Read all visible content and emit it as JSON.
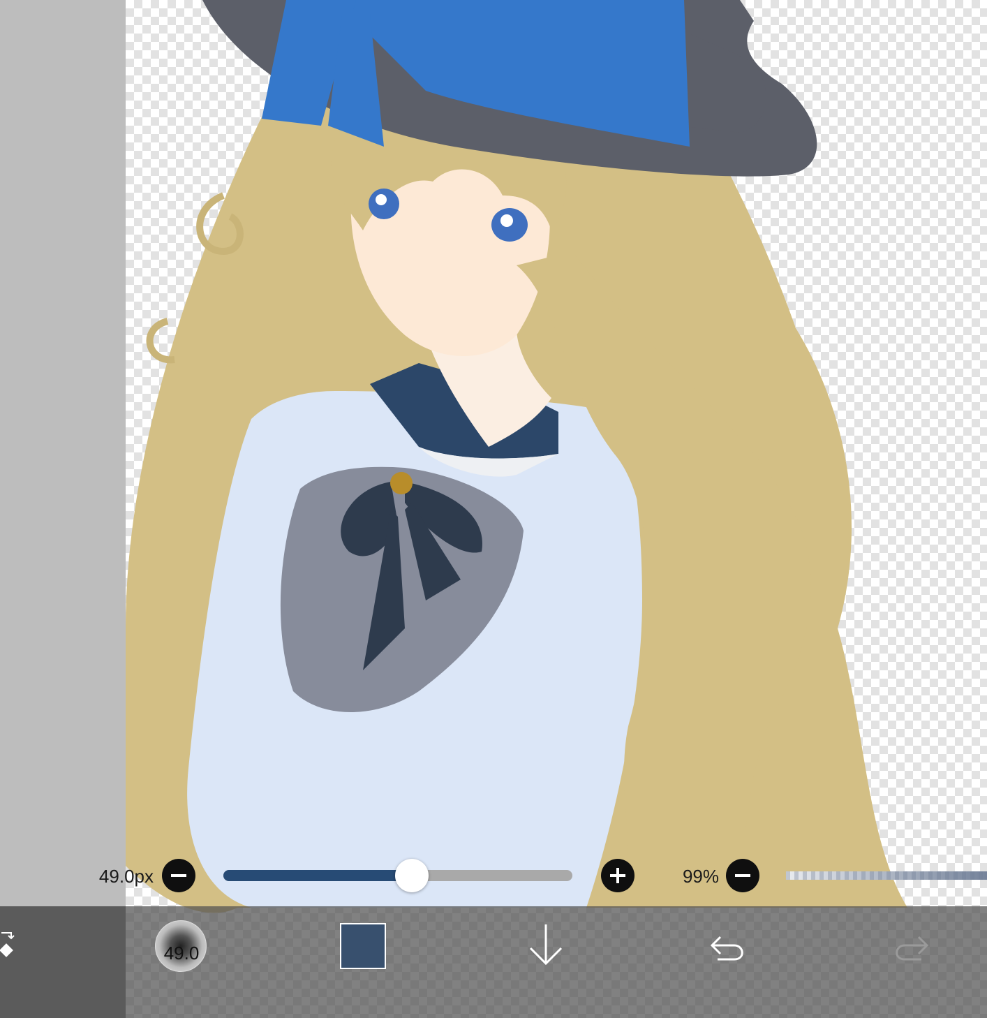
{
  "brush_size": {
    "label": "49.0px",
    "decrease_label": "−",
    "increase_label": "+",
    "level": 0.54
  },
  "opacity": {
    "label": "99%",
    "decrease_label": "−",
    "level": 0.99
  },
  "toolbar": {
    "brush_size_badge": "49.0",
    "current_color": "#38506e",
    "accent_color": "#274b75",
    "icons": {
      "tool": "eraser-swap-icon",
      "download": "arrow-down-icon",
      "undo": "undo-icon",
      "redo": "redo-icon"
    }
  }
}
